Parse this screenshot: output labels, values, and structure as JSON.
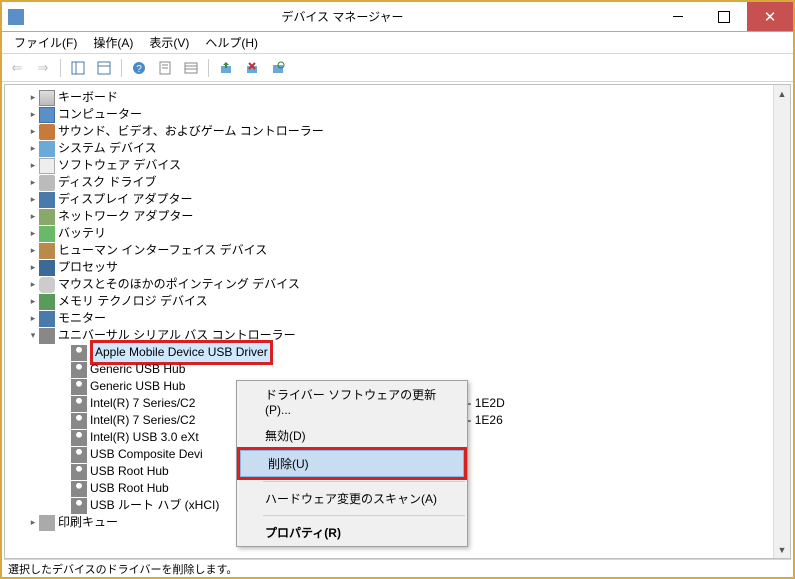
{
  "window": {
    "title": "デバイス マネージャー"
  },
  "menubar": {
    "file": "ファイル(F)",
    "action": "操作(A)",
    "view": "表示(V)",
    "help": "ヘルプ(H)"
  },
  "tree": {
    "items": [
      {
        "label": "キーボード",
        "icon": "keyboard"
      },
      {
        "label": "コンピューター",
        "icon": "computer"
      },
      {
        "label": "サウンド、ビデオ、およびゲーム コントローラー",
        "icon": "sound"
      },
      {
        "label": "システム デバイス",
        "icon": "system"
      },
      {
        "label": "ソフトウェア デバイス",
        "icon": "software"
      },
      {
        "label": "ディスク ドライブ",
        "icon": "disk"
      },
      {
        "label": "ディスプレイ アダプター",
        "icon": "display"
      },
      {
        "label": "ネットワーク アダプター",
        "icon": "network"
      },
      {
        "label": "バッテリ",
        "icon": "battery"
      },
      {
        "label": "ヒューマン インターフェイス デバイス",
        "icon": "hid"
      },
      {
        "label": "プロセッサ",
        "icon": "cpu"
      },
      {
        "label": "マウスとそのほかのポインティング デバイス",
        "icon": "mouse"
      },
      {
        "label": "メモリ テクノロジ デバイス",
        "icon": "memory"
      },
      {
        "label": "モニター",
        "icon": "monitor"
      }
    ],
    "usb_category": "ユニバーサル シリアル バス コントローラー",
    "usb_children": [
      {
        "label": "Apple Mobile Device USB Driver",
        "selected": true
      },
      {
        "label": "Generic USB Hub"
      },
      {
        "label": "Generic USB Hub"
      },
      {
        "label": "Intel(R) 7 Series/C2"
      },
      {
        "label": "Intel(R) 7 Series/C2"
      },
      {
        "label": "Intel(R) USB 3.0 eXt"
      },
      {
        "label": "USB Composite Devi"
      },
      {
        "label": "USB Root Hub"
      },
      {
        "label": "USB Root Hub"
      },
      {
        "label": "USB ルート ハブ (xHCI)"
      }
    ],
    "usb_tail": [
      {
        "suffix": "oller - 1E2D"
      },
      {
        "suffix": "oller - 1E26"
      }
    ],
    "last_cat": "印刷キュー"
  },
  "context_menu": {
    "update": "ドライバー ソフトウェアの更新(P)...",
    "disable": "無効(D)",
    "delete": "削除(U)",
    "scan": "ハードウェア変更のスキャン(A)",
    "properties": "プロパティ(R)"
  },
  "statusbar": {
    "text": "選択したデバイスのドライバーを削除します。"
  }
}
